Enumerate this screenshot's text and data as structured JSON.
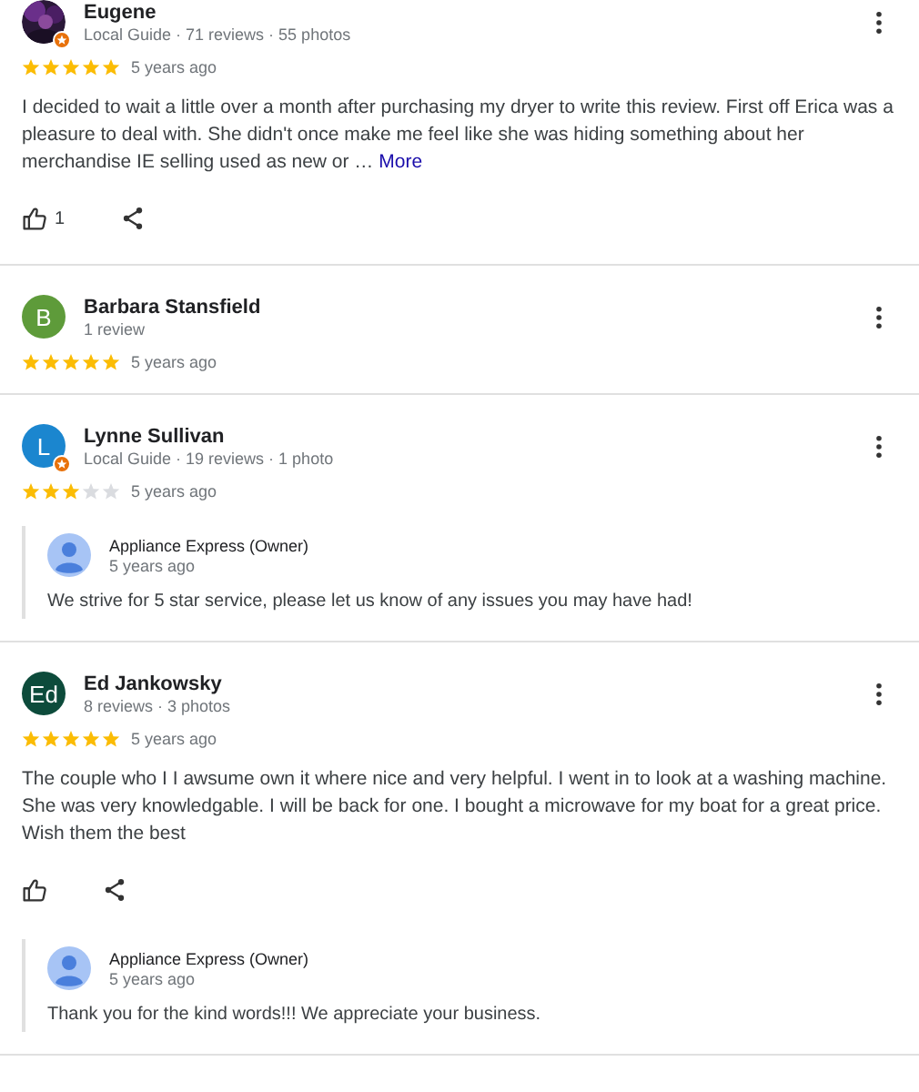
{
  "reviews": [
    {
      "name": "Eugene",
      "local_guide": true,
      "meta": "Local Guide · 71 reviews · 55 photos",
      "stars": 5,
      "time": "5 years ago",
      "text": "I decided to wait a little over a month after purchasing my dryer to write this review. First off Erica was a pleasure to deal with. She didn't once make me feel like she was hiding something about her merchandise IE selling used as new or …",
      "more": "More",
      "has_actions": true,
      "like_count": "1"
    },
    {
      "name": "Barbara Stansfield",
      "avatar": {
        "kind": "letter",
        "letter": "B",
        "color": "#5e9b3a"
      },
      "local_guide": false,
      "meta": "1 review",
      "stars": 5,
      "time": "5 years ago",
      "has_actions": false
    },
    {
      "name": "Lynne Sullivan",
      "avatar": {
        "kind": "letter",
        "letter": "L",
        "color": "#1b86cf"
      },
      "local_guide": true,
      "meta": "Local Guide · 19 reviews · 1 photo",
      "stars": 3,
      "time": "5 years ago",
      "has_actions": false,
      "response": {
        "name": "Appliance Express (Owner)",
        "time": "5 years ago",
        "text": "We strive for 5 star service, please let us know of any issues you may have had!"
      }
    },
    {
      "name": "Ed Jankowsky",
      "avatar": {
        "kind": "letter",
        "letter": "Ed",
        "color": "#0d4b3b"
      },
      "local_guide": false,
      "meta": "8 reviews · 3 photos",
      "stars": 5,
      "time": "5 years ago",
      "text": "The couple who I I awsume own it where nice and very helpful. I went in to look at a washing machine. She was very knowledgable. I will be back for one. I bought a microwave for my boat for a great price. Wish them the best",
      "has_actions": true,
      "response": {
        "name": "Appliance Express (Owner)",
        "time": "5 years ago",
        "text": "Thank you for the kind words!!! We appreciate your business."
      }
    }
  ]
}
